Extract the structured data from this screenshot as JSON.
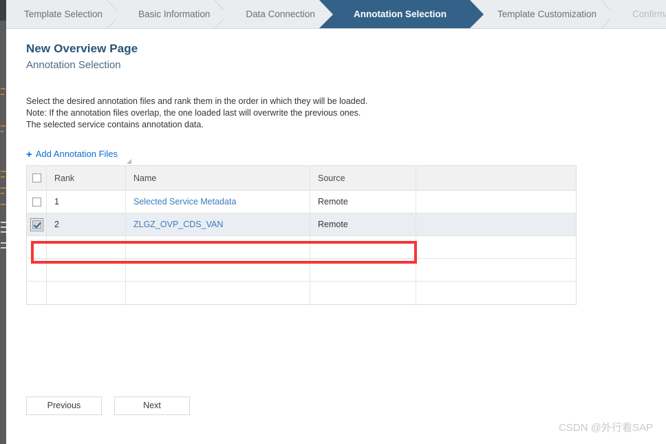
{
  "wizard": {
    "steps": [
      {
        "label": "Template Selection",
        "state": "done"
      },
      {
        "label": "Basic Information",
        "state": "done"
      },
      {
        "label": "Data Connection",
        "state": "done"
      },
      {
        "label": "Annotation Selection",
        "state": "active"
      },
      {
        "label": "Template Customization",
        "state": "todo"
      },
      {
        "label": "Confirmation",
        "state": "disabled"
      }
    ]
  },
  "page": {
    "title": "New Overview Page",
    "subtitle": "Annotation Selection",
    "intro_line1": "Select the desired annotation files and rank them in the order in which they will be loaded.",
    "intro_line2": "Note: If the annotation files overlap, the one loaded last will overwrite the previous ones.",
    "intro_line3": "The selected service contains annotation data."
  },
  "toolbar": {
    "add_label": "Add Annotation Files",
    "add_icon": "plus-icon",
    "resize_grip_icon": "resize-grip-icon"
  },
  "table": {
    "columns": [
      "Rank",
      "Name",
      "Source"
    ],
    "select_all_checked": false,
    "rows": [
      {
        "checked": false,
        "focused": false,
        "rank": "1",
        "name": "Selected Service Metadata",
        "source": "Remote",
        "extra": ""
      },
      {
        "checked": true,
        "focused": true,
        "rank": "2",
        "name": "ZLGZ_OVP_CDS_VAN",
        "source": "Remote",
        "extra": ""
      },
      {
        "checked": null,
        "focused": false,
        "rank": "",
        "name": "",
        "source": "",
        "extra": ""
      },
      {
        "checked": null,
        "focused": false,
        "rank": "",
        "name": "",
        "source": "",
        "extra": ""
      },
      {
        "checked": null,
        "focused": false,
        "rank": "",
        "name": "",
        "source": "",
        "extra": ""
      }
    ]
  },
  "footer": {
    "previous_label": "Previous",
    "next_label": "Next"
  },
  "watermark": {
    "text": "CSDN @外行看SAP"
  },
  "colors": {
    "wizard_active_bg": "#346187",
    "wizard_bg": "#eaedef",
    "title": "#265477",
    "link": "#3a7bbf",
    "accent_link": "#0a6ed1",
    "annotation_rect": "#f73636",
    "row_selected_bg": "#eaeef3",
    "table_header_bg": "#f1f1f1"
  }
}
